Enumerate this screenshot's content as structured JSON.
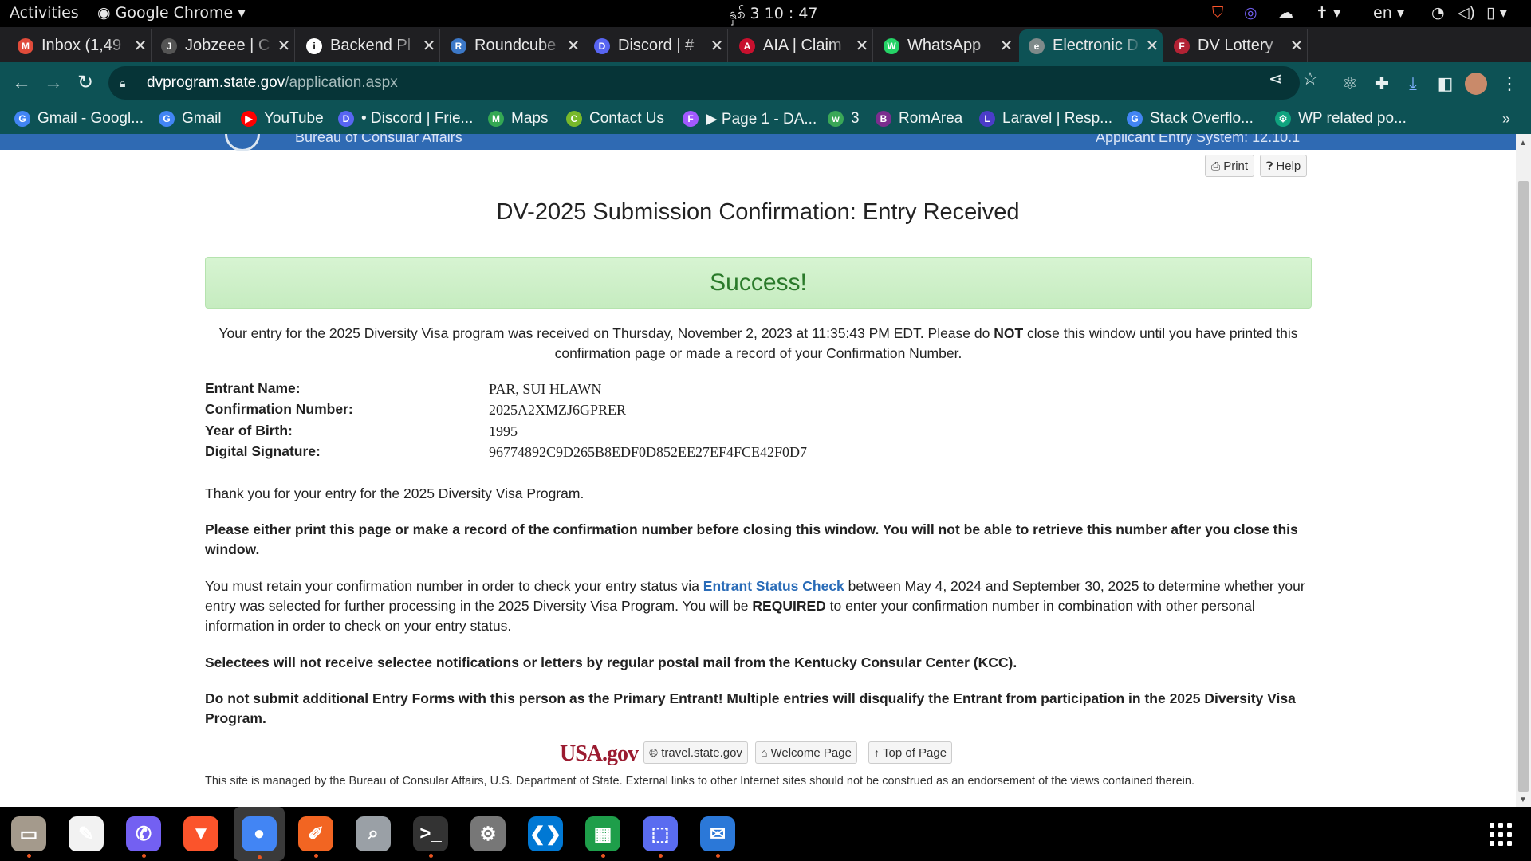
{
  "system": {
    "activities": "Activities",
    "app_name": "Google Chrome",
    "clock": "နှစ် 3  10 : 47",
    "lang": "en"
  },
  "tabs": [
    {
      "title": "Inbox (1,49",
      "icon": "gmail-icon",
      "color": "#e04b3a",
      "glyph": "M"
    },
    {
      "title": "Jobzeee | C",
      "icon": "jobzeee-icon",
      "color": "#555555",
      "glyph": "J"
    },
    {
      "title": "Backend Pl",
      "icon": "info-icon",
      "color": "#ffffff",
      "glyph": "i"
    },
    {
      "title": "Roundcube",
      "icon": "roundcube-icon",
      "color": "#3c78c8",
      "glyph": "R"
    },
    {
      "title": "Discord | #",
      "icon": "discord-icon",
      "color": "#5865f2",
      "glyph": "D"
    },
    {
      "title": "AIA | Claim",
      "icon": "aia-icon",
      "color": "#c8102e",
      "glyph": "A"
    },
    {
      "title": "WhatsApp",
      "icon": "whatsapp-icon",
      "color": "#25d366",
      "glyph": "W"
    },
    {
      "title": "Electronic D",
      "icon": "globe-icon",
      "color": "#7f8a8a",
      "glyph": "e",
      "active": true
    },
    {
      "title": "DV Lottery",
      "icon": "flag-icon",
      "color": "#b22234",
      "glyph": "F"
    }
  ],
  "url": {
    "host": "dvprogram.state.gov",
    "path": "/application.aspx"
  },
  "bookmarks": [
    {
      "label": "Gmail - Googl...",
      "icon": "google-icon",
      "color": "#4285f4",
      "glyph": "G"
    },
    {
      "label": "Gmail",
      "icon": "google-icon",
      "color": "#4285f4",
      "glyph": "G"
    },
    {
      "label": "YouTube",
      "icon": "youtube-icon",
      "color": "#ff0000",
      "glyph": "▶"
    },
    {
      "label": "• Discord | Frie...",
      "icon": "discord-icon",
      "color": "#5865f2",
      "glyph": "D"
    },
    {
      "label": "Maps",
      "icon": "maps-icon",
      "color": "#34a853",
      "glyph": "M"
    },
    {
      "label": "Contact Us",
      "icon": "leaf-icon",
      "color": "#78b82a",
      "glyph": "C"
    },
    {
      "label": "▶ Page 1 - DA...",
      "icon": "figma-icon",
      "color": "#a259ff",
      "glyph": "F"
    },
    {
      "label": "3",
      "icon": "w-icon",
      "color": "#3aa757",
      "glyph": "w"
    },
    {
      "label": "RomArea",
      "icon": "b-icon",
      "color": "#7b2d8e",
      "glyph": "B"
    },
    {
      "label": "Laravel | Resp...",
      "icon": "laravel-icon",
      "color": "#4b3cc8",
      "glyph": "L"
    },
    {
      "label": "Stack Overflo...",
      "icon": "google-icon",
      "color": "#4285f4",
      "glyph": "G"
    },
    {
      "label": "WP related po...",
      "icon": "chatgpt-icon",
      "color": "#10a37f",
      "glyph": "⚙"
    }
  ],
  "banner": {
    "left_text": "Bureau of Consular Affairs",
    "right_text": "Applicant Entry System: 12.10.1"
  },
  "page": {
    "print_label": "Print",
    "help_label": "Help",
    "heading": "DV-2025 Submission Confirmation: Entry Received",
    "success": "Success!",
    "intro_1": "Your entry for the 2025 Diversity Visa program was received on Thursday, November 2, 2023 at 11:35:43 PM EDT. Please do ",
    "intro_not": "NOT",
    "intro_2": " close this window until you have printed this confirmation page or made a record of your Confirmation Number.",
    "details": [
      {
        "label": "Entrant Name:",
        "value": "PAR, SUI HLAWN"
      },
      {
        "label": "Confirmation Number:",
        "value": "2025A2XMZJ6GPRER"
      },
      {
        "label": "Year of Birth:",
        "value": "1995"
      },
      {
        "label": "Digital Signature:",
        "value": "96774892C9D265B8EDF0D852EE27EF4FCE42F0D7"
      }
    ],
    "thanks": "Thank you for your entry for the 2025 Diversity Visa Program.",
    "warn_print": "Please either print this page or make a record of the confirmation number before closing this window. You will not be able to retrieve this number after you close this window.",
    "retain_1": "You must retain your confirmation number in order to check your entry status via ",
    "retain_link": "Entrant Status Check",
    "retain_2": " between May 4, 2024 and September 30, 2025 to determine whether your entry was selected for further processing in the 2025 Diversity Visa Program. You will be ",
    "retain_req": "REQUIRED",
    "retain_3": " to enter your confirmation number in combination with other personal information in order to check on your entry status.",
    "selectees": "Selectees will not receive selectee notifications or letters by regular postal mail from the Kentucky Consular Center (KCC).",
    "no_additional": "Do not submit additional Entry Forms with this person as the Primary Entrant! Multiple entries will disqualify the Entrant from participation in the 2025 Diversity Visa Program.",
    "usagov": "USA.gov",
    "travel_link": "travel.state.gov",
    "welcome_link": "Welcome Page",
    "top_link": "Top of Page",
    "footer": "This site is managed by the Bureau of Consular Affairs, U.S. Department of State. External links to other Internet sites should not be construed as an endorsement of the views contained therein."
  },
  "dock": [
    {
      "name": "files-icon",
      "color": "#a49a8c",
      "glyph": "▭"
    },
    {
      "name": "text-editor-icon",
      "color": "#f2f2f2",
      "glyph": "✎"
    },
    {
      "name": "viber-icon",
      "color": "#7360f2",
      "glyph": "✆"
    },
    {
      "name": "brave-icon",
      "color": "#fb542b",
      "glyph": "▼"
    },
    {
      "name": "chrome-icon",
      "color": "#4285f4",
      "glyph": "●",
      "running": true
    },
    {
      "name": "pen-tool-icon",
      "color": "#f26522",
      "glyph": "✐"
    },
    {
      "name": "image-viewer-icon",
      "color": "#9aa0a6",
      "glyph": "⌕"
    },
    {
      "name": "terminal-icon",
      "color": "#333333",
      "glyph": ">_"
    },
    {
      "name": "settings-icon",
      "color": "#777777",
      "glyph": "⚙"
    },
    {
      "name": "vscode-icon",
      "color": "#0078d4",
      "glyph": "❮❯"
    },
    {
      "name": "spreadsheet-icon",
      "color": "#1e9e4a",
      "glyph": "▦"
    },
    {
      "name": "screenshot-icon",
      "color": "#5a6cf0",
      "glyph": "⬚"
    },
    {
      "name": "thunderbird-icon",
      "color": "#2b78d8",
      "glyph": "✉"
    }
  ]
}
